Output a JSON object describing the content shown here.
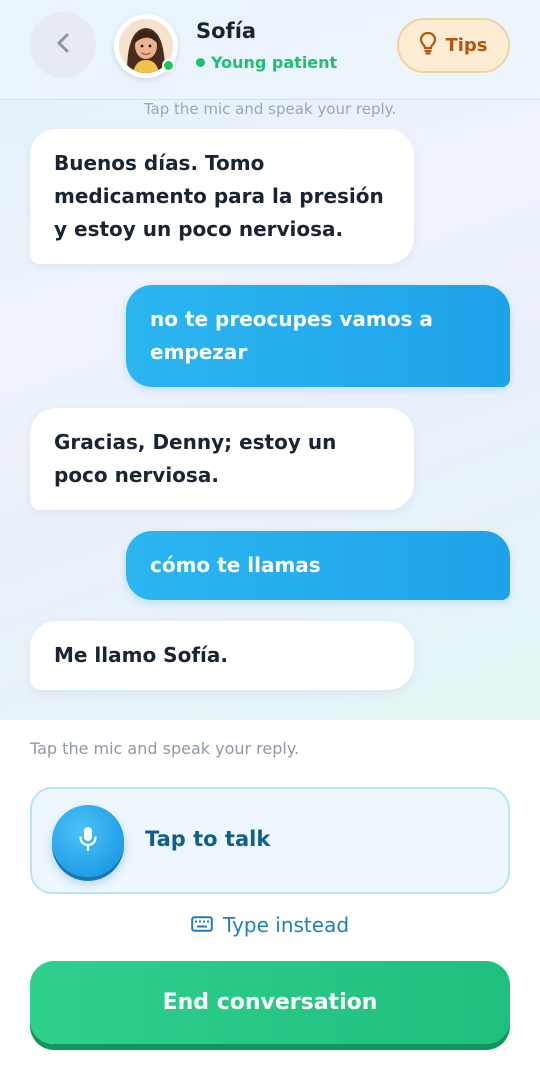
{
  "header": {
    "name": "Sofía",
    "status": "Young patient",
    "tips_label": "Tips"
  },
  "hint_top": "Tap the mic and speak your reply.",
  "messages": [
    {
      "role": "patient",
      "text": "Buenos días. Tomo medicamento para la presión y estoy un poco nerviosa."
    },
    {
      "role": "user",
      "text": "no te preocupes vamos a empezar"
    },
    {
      "role": "patient",
      "text": "Gracias, Denny; estoy un poco nerviosa."
    },
    {
      "role": "user",
      "text": "cómo te llamas"
    },
    {
      "role": "patient",
      "text": "Me llamo Sofía."
    }
  ],
  "input": {
    "hint": "Tap the mic and speak your reply.",
    "talk_label": "Tap to talk",
    "type_instead_label": "Type instead"
  },
  "end_label": "End conversation",
  "icons": {
    "back": "chevron-left-icon",
    "tips": "lightbulb-icon",
    "mic": "microphone-icon",
    "keyboard": "keyboard-icon"
  },
  "colors": {
    "accent_blue": "#229fe8",
    "status_green": "#1fbf73",
    "end_green": "#1fbf7e",
    "tips_orange": "#b4560b"
  }
}
